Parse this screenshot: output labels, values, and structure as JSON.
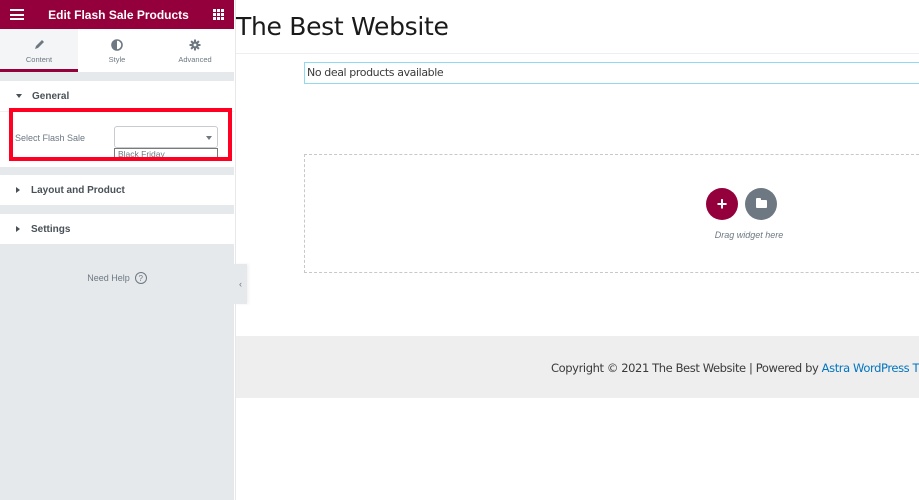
{
  "panel": {
    "title": "Edit Flash Sale Products",
    "menu_icon": "hamburger-icon",
    "apps_icon": "grid-icon",
    "tabs": [
      {
        "label": "Content",
        "icon": "pencil-icon",
        "active": true
      },
      {
        "label": "Style",
        "icon": "half-circle-icon",
        "active": false
      },
      {
        "label": "Advanced",
        "icon": "gear-icon",
        "active": false
      }
    ],
    "sections": [
      {
        "label": "General",
        "expanded": true
      },
      {
        "label": "Layout and Product",
        "expanded": false
      },
      {
        "label": "Settings",
        "expanded": false
      }
    ],
    "general": {
      "field_label": "Select Flash Sale",
      "select_value": "",
      "dropdown_options": [
        "Black Friday"
      ]
    },
    "need_help": "Need Help",
    "help_icon": "?"
  },
  "collapse_handle": "‹",
  "preview": {
    "site_title": "The Best Website",
    "deal_message": "No deal products available",
    "drop_zone": {
      "add_icon": "+",
      "text": "Drag widget here"
    },
    "footer": {
      "text": "Copyright © 2021 The Best Website | Powered by ",
      "link": "Astra WordPress Theme"
    }
  },
  "colors": {
    "brand": "#93003c",
    "highlight": "#ff0022",
    "link": "#0274be"
  }
}
